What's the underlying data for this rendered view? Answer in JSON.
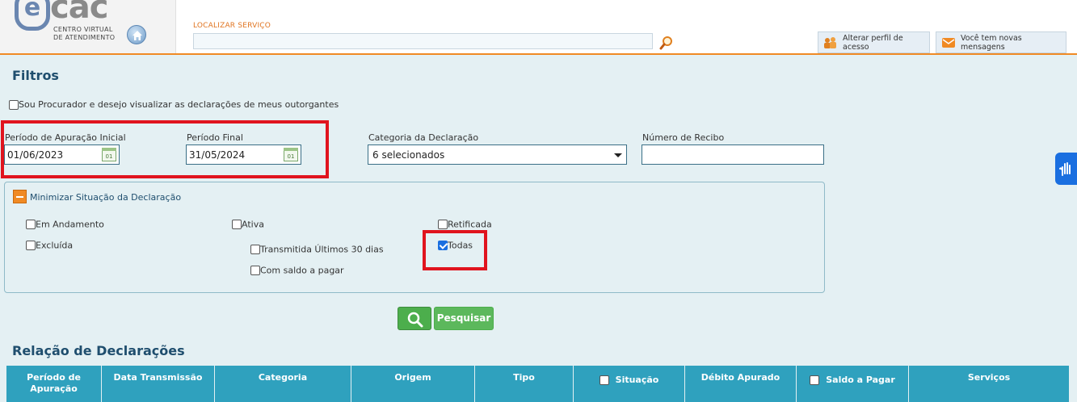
{
  "header": {
    "logo_mark": "e",
    "logo_text": "cac",
    "logo_subtitle_1": "CENTRO VIRTUAL",
    "logo_subtitle_2": "DE ATENDIMENTO",
    "search_label": "LOCALIZAR SERVIÇO",
    "search_value": "",
    "btn_perfil": "Alterar perfil de acesso",
    "btn_mensagens": "Você tem novas mensagens"
  },
  "filters": {
    "title": "Filtros",
    "procurador_label": "Sou Procurador e desejo visualizar as declarações de meus outorgantes",
    "procurador_checked": false,
    "periodo_inicial_label": "Período de Apuração Inicial",
    "periodo_inicial_value": "01/06/2023",
    "periodo_final_label": "Período Final",
    "periodo_final_value": "31/05/2024",
    "categoria_label": "Categoria da Declaração",
    "categoria_value": "6 selecionados",
    "recibo_label": "Número de Recibo",
    "recibo_value": "",
    "calendar_icon_text": "01"
  },
  "situacao": {
    "toggle_label": "Minimizar Situação da Declaração",
    "options": {
      "em_andamento": "Em Andamento",
      "excluida": "Excluída",
      "ativa": "Ativa",
      "transmitida": "Transmitida Últimos 30 dias",
      "com_saldo": "Com saldo a pagar",
      "retificada": "Retificada",
      "todas": "Todas"
    }
  },
  "actions": {
    "pesquisar": "Pesquisar"
  },
  "table": {
    "title": "Relação de Declarações",
    "columns": {
      "periodo": "Período de Apuração",
      "data_transmissao": "Data Transmissão",
      "categoria": "Categoria",
      "origem": "Origem",
      "tipo": "Tipo",
      "situacao": "Situação",
      "debito": "Débito Apurado",
      "saldo": "Saldo a Pagar",
      "servicos": "Serviços"
    }
  },
  "colors": {
    "accent_orange": "#f08a24",
    "header_blue": "#2fa1be",
    "highlight_red": "#e0141e",
    "button_green": "#5cb85c"
  }
}
